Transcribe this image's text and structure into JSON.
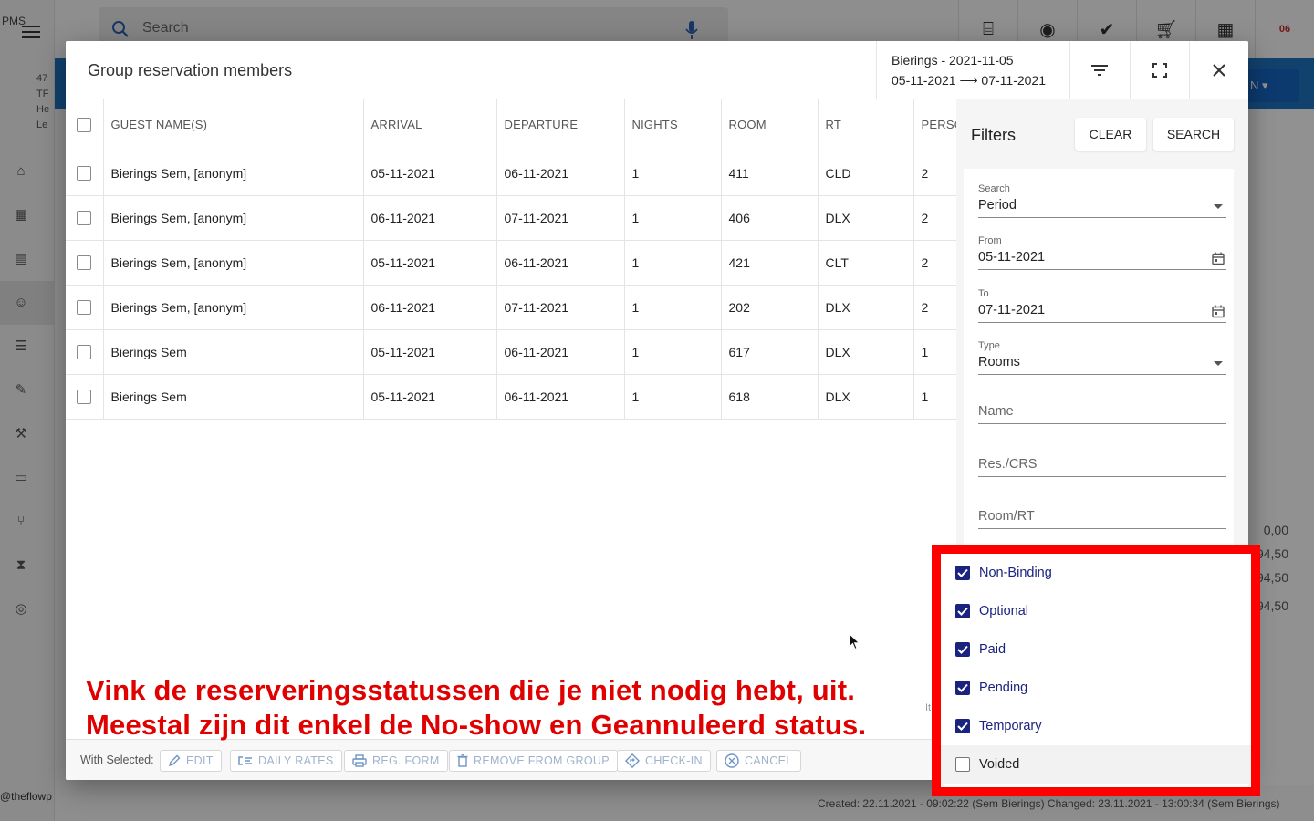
{
  "background": {
    "app_label": "PMS",
    "search_placeholder": "Search",
    "rail_info": [
      "47",
      "TF",
      "He",
      "Le"
    ],
    "calendar_badge": "06",
    "blue_button_label": "N",
    "right_values": [
      "0,00",
      "94,50",
      "94,50",
      "94,50"
    ],
    "footer_text": "Created: 22.11.2021 - 09:02:22 (Sem Bierings)    Changed: 23.11.2021 - 13:00:34 (Sem Bierings)",
    "handle": "@theflowp"
  },
  "dialog": {
    "title": "Group reservation members",
    "context_line1": "Bierings - 2021-11-05",
    "context_line2": "05-11-2021 ⟶ 07-11-2021"
  },
  "table": {
    "headers": [
      "GUEST NAME(S)",
      "ARRIVAL",
      "DEPARTURE",
      "NIGHTS",
      "ROOM",
      "RT",
      "PERSO"
    ],
    "rows": [
      {
        "guest": "Bierings Sem, [anonym]",
        "arrival": "05-11-2021",
        "departure": "06-11-2021",
        "nights": "1",
        "room": "411",
        "rt": "CLD",
        "persons": "2"
      },
      {
        "guest": "Bierings Sem, [anonym]",
        "arrival": "06-11-2021",
        "departure": "07-11-2021",
        "nights": "1",
        "room": "406",
        "rt": "DLX",
        "persons": "2"
      },
      {
        "guest": "Bierings Sem, [anonym]",
        "arrival": "05-11-2021",
        "departure": "06-11-2021",
        "nights": "1",
        "room": "421",
        "rt": "CLT",
        "persons": "2"
      },
      {
        "guest": "Bierings Sem, [anonym]",
        "arrival": "06-11-2021",
        "departure": "07-11-2021",
        "nights": "1",
        "room": "202",
        "rt": "DLX",
        "persons": "2"
      },
      {
        "guest": "Bierings Sem",
        "arrival": "05-11-2021",
        "departure": "06-11-2021",
        "nights": "1",
        "room": "617",
        "rt": "DLX",
        "persons": "1"
      },
      {
        "guest": "Bierings Sem",
        "arrival": "05-11-2021",
        "departure": "06-11-2021",
        "nights": "1",
        "room": "618",
        "rt": "DLX",
        "persons": "1"
      }
    ]
  },
  "filters": {
    "title": "Filters",
    "clear_label": "CLEAR",
    "search_label": "SEARCH",
    "search_field": {
      "label": "Search",
      "value": "Period"
    },
    "from_field": {
      "label": "From",
      "value": "05-11-2021"
    },
    "to_field": {
      "label": "To",
      "value": "07-11-2021"
    },
    "type_field": {
      "label": "Type",
      "value": "Rooms"
    },
    "name_placeholder": "Name",
    "res_placeholder": "Res./CRS",
    "room_placeholder": "Room/RT",
    "statuses": [
      {
        "label": "Non-Binding",
        "checked": true
      },
      {
        "label": "Optional",
        "checked": true
      },
      {
        "label": "Paid",
        "checked": true
      },
      {
        "label": "Pending",
        "checked": true
      },
      {
        "label": "Temporary",
        "checked": true
      },
      {
        "label": "Voided",
        "checked": false
      }
    ]
  },
  "actions": {
    "with_selected": "With Selected:",
    "edit": "EDIT",
    "daily_rates": "DAILY RATES",
    "reg_form": "REG. FORM",
    "remove_from_group": "REMOVE FROM GROUP",
    "check_in": "CHECK-IN",
    "cancel": "CANCEL",
    "items_hint": "It"
  },
  "annotation": {
    "line1": "Vink de reserveringsstatussen die je niet nodig hebt, uit.",
    "line2": "Meestal zijn dit enkel de No-show en Geannuleerd status."
  },
  "colors": {
    "accent_navy": "#1a237e",
    "highlight_red": "#ff0000",
    "annotation_red": "#e00000",
    "brand_blue": "#1e73be"
  }
}
